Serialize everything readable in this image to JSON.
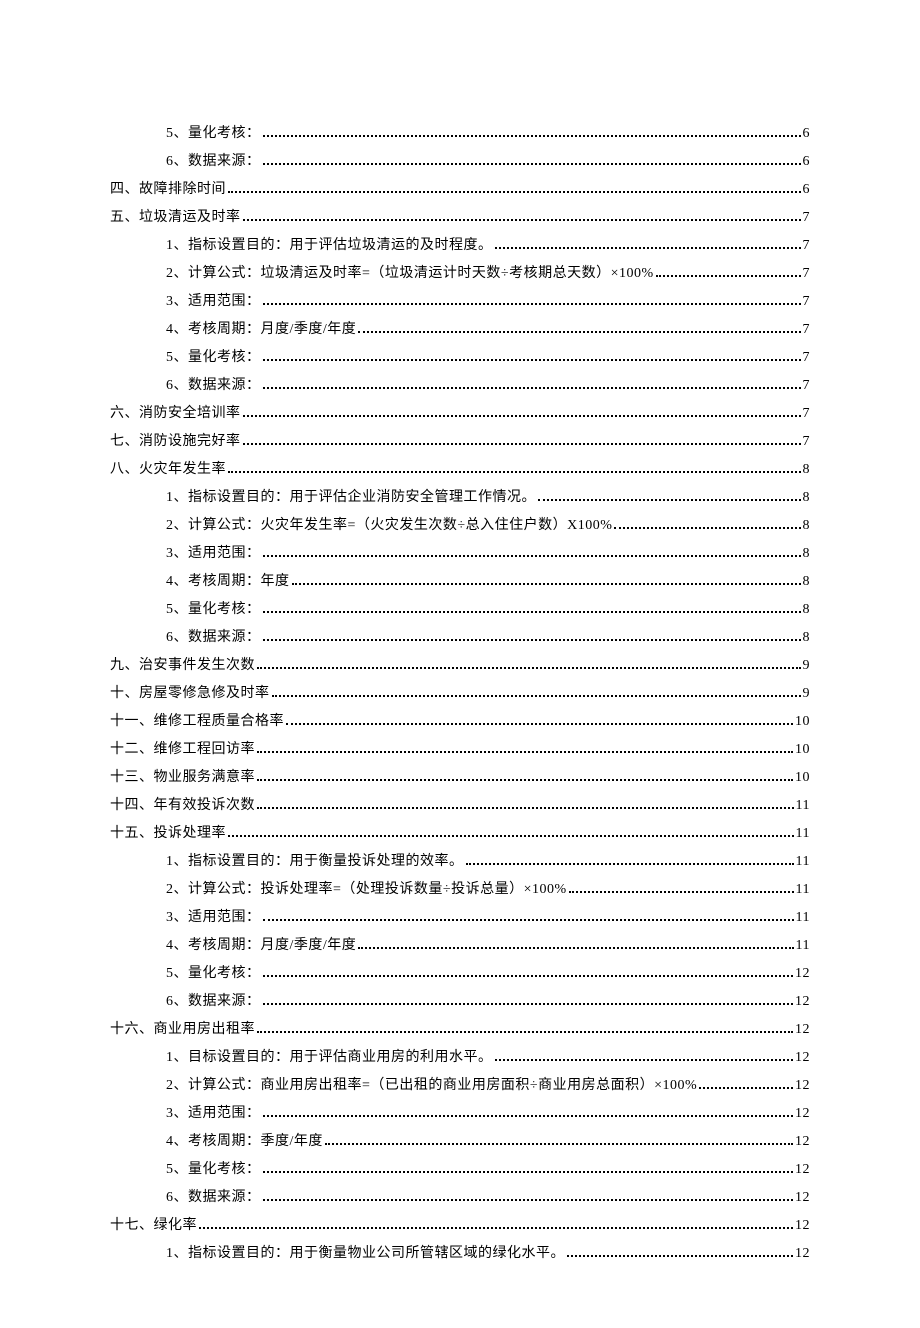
{
  "toc": [
    {
      "level": 2,
      "label": "5、量化考核：",
      "page": "6"
    },
    {
      "level": 2,
      "label": "6、数据来源：",
      "page": "6"
    },
    {
      "level": 1,
      "label": "四、故障排除时间",
      "page": "6"
    },
    {
      "level": 1,
      "label": "五、垃圾清运及时率",
      "page": "7"
    },
    {
      "level": 2,
      "label": "1、指标设置目的：用于评估垃圾清运的及时程度。",
      "page": "7"
    },
    {
      "level": 2,
      "label": "2、计算公式：垃圾清运及时率=（垃圾清运计时天数÷考核期总天数）×100%",
      "page": "7"
    },
    {
      "level": 2,
      "label": "3、适用范围：",
      "page": "7"
    },
    {
      "level": 2,
      "label": "4、考核周期：月度/季度/年度",
      "page": "7"
    },
    {
      "level": 2,
      "label": "5、量化考核：",
      "page": "7"
    },
    {
      "level": 2,
      "label": "6、数据来源：",
      "page": "7"
    },
    {
      "level": 1,
      "label": "六、消防安全培训率",
      "page": "7"
    },
    {
      "level": 1,
      "label": "七、消防设施完好率",
      "page": "7"
    },
    {
      "level": 1,
      "label": "八、火灾年发生率",
      "page": "8"
    },
    {
      "level": 2,
      "label": "1、指标设置目的：用于评估企业消防安全管理工作情况。",
      "page": "8"
    },
    {
      "level": 2,
      "label": "2、计算公式：火灾年发生率=（火灾发生次数÷总入住住户数）X100%",
      "page": "8"
    },
    {
      "level": 2,
      "label": "3、适用范围：",
      "page": "8"
    },
    {
      "level": 2,
      "label": "4、考核周期：年度",
      "page": "8"
    },
    {
      "level": 2,
      "label": "5、量化考核：",
      "page": "8"
    },
    {
      "level": 2,
      "label": "6、数据来源：",
      "page": "8"
    },
    {
      "level": 1,
      "label": "九、治安事件发生次数",
      "page": "9"
    },
    {
      "level": 1,
      "label": "十、房屋零修急修及时率",
      "page": "9"
    },
    {
      "level": 1,
      "label": "十一、维修工程质量合格率",
      "page": "10"
    },
    {
      "level": 1,
      "label": "十二、维修工程回访率",
      "page": "10"
    },
    {
      "level": 1,
      "label": "十三、物业服务满意率",
      "page": "10"
    },
    {
      "level": 1,
      "label": "十四、年有效投诉次数",
      "page": "11"
    },
    {
      "level": 1,
      "label": "十五、投诉处理率",
      "page": "11"
    },
    {
      "level": 2,
      "label": "1、指标设置目的：用于衡量投诉处理的效率。",
      "page": "11"
    },
    {
      "level": 2,
      "label": "2、计算公式：投诉处理率=（处理投诉数量÷投诉总量）×100%",
      "page": "11"
    },
    {
      "level": 2,
      "label": "3、适用范围：",
      "page": "11"
    },
    {
      "level": 2,
      "label": "4、考核周期：月度/季度/年度",
      "page": "11"
    },
    {
      "level": 2,
      "label": "5、量化考核：",
      "page": "12"
    },
    {
      "level": 2,
      "label": "6、数据来源：",
      "page": "12"
    },
    {
      "level": 1,
      "label": "十六、商业用房出租率",
      "page": "12"
    },
    {
      "level": 2,
      "label": "1、目标设置目的：用于评估商业用房的利用水平。",
      "page": "12"
    },
    {
      "level": 2,
      "label": "2、计算公式：商业用房出租率=（已出租的商业用房面积÷商业用房总面积）×100%",
      "page": "12"
    },
    {
      "level": 2,
      "label": "3、适用范围：",
      "page": "12"
    },
    {
      "level": 2,
      "label": "4、考核周期：季度/年度",
      "page": "12"
    },
    {
      "level": 2,
      "label": "5、量化考核：",
      "page": "12"
    },
    {
      "level": 2,
      "label": "6、数据来源：",
      "page": "12"
    },
    {
      "level": 1,
      "label": "十七、绿化率",
      "page": "12"
    },
    {
      "level": 2,
      "label": "1、指标设置目的：用于衡量物业公司所管辖区域的绿化水平。",
      "page": "12"
    }
  ]
}
